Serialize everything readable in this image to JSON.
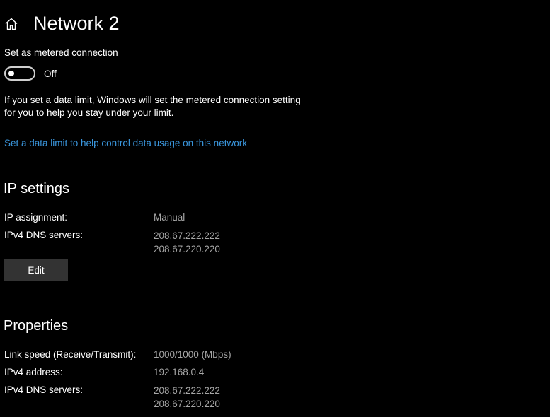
{
  "header": {
    "title": "Network 2",
    "home_icon": "home-icon"
  },
  "metered": {
    "label": "Set as metered connection",
    "toggle_state": "Off",
    "toggle_on": false,
    "description_line1": "If you set a data limit, Windows will set the metered connection setting",
    "description_line2": "for you to help you stay under your limit.",
    "link": "Set a data limit to help control data usage on this network"
  },
  "ip_settings": {
    "heading": "IP settings",
    "assignment_label": "IP assignment:",
    "assignment_value": "Manual",
    "dns_label": "IPv4 DNS servers:",
    "dns_values": [
      "208.67.222.222",
      "208.67.220.220"
    ],
    "edit_button": "Edit"
  },
  "properties": {
    "heading": "Properties",
    "rows": [
      {
        "label": "Link speed (Receive/Transmit):",
        "values": [
          "1000/1000 (Mbps)"
        ]
      },
      {
        "label": "IPv4 address:",
        "values": [
          "192.168.0.4"
        ]
      },
      {
        "label": "IPv4 DNS servers:",
        "values": [
          "208.67.222.222",
          "208.67.220.220"
        ]
      }
    ]
  },
  "colors": {
    "background": "#000000",
    "text": "#ffffff",
    "value_text": "#a6a6a6",
    "link": "#3a96dd",
    "button": "#333333"
  }
}
